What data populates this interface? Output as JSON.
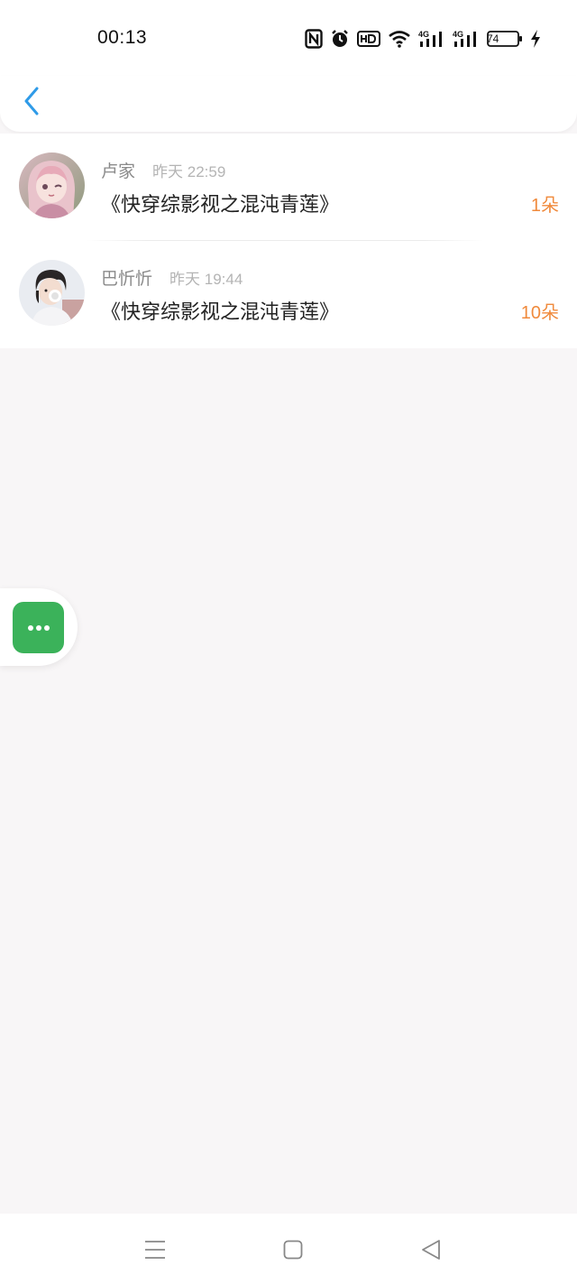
{
  "status_bar": {
    "time": "00:13",
    "icons": [
      "nfc-icon",
      "alarm-icon",
      "hd-icon",
      "wifi-icon",
      "signal-4g-icon",
      "signal-4g-icon",
      "battery-icon",
      "charging-icon"
    ],
    "battery_level": "74"
  },
  "header": {
    "back_icon": "chevron-left-icon",
    "accent_color": "#2f9be8"
  },
  "rows": [
    {
      "username": "卢家",
      "timestamp": "昨天 22:59",
      "title": "《快穿综影视之混沌青莲》",
      "amount": "1朵"
    },
    {
      "username": "巴忻忻",
      "timestamp": "昨天 19:44",
      "title": "《快穿综影视之混沌青莲》",
      "amount": "10朵"
    }
  ],
  "colors": {
    "amount": "#f08a3c",
    "more_button": "#3bb25a",
    "background": "#f8f6f7"
  },
  "floating": {
    "icon": "more-dots-icon"
  },
  "nav_bar": {
    "icons": [
      "menu-icon",
      "home-square-icon",
      "back-triangle-icon"
    ]
  }
}
